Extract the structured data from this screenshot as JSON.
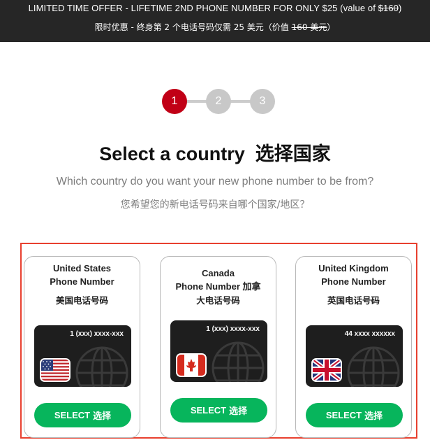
{
  "banner": {
    "line1_prefix": "LIMITED TIME OFFER - LIFETIME 2ND PHONE NUMBER FOR ONLY $25 (value of ",
    "line1_strike": "$160",
    "line1_suffix": ")",
    "line2_prefix": "限时优惠 - 终身第 2 个电话号码仅需 25 美元（价值 ",
    "line2_strike": "160 美元",
    "line2_suffix": "）"
  },
  "steps": [
    {
      "label": "1",
      "active": true
    },
    {
      "label": "2",
      "active": false
    },
    {
      "label": "3",
      "active": false
    }
  ],
  "heading": {
    "title_en": "Select a country",
    "title_zh": "选择国家",
    "subtitle_en": "Which country do you want your new phone number to be from?",
    "subtitle_zh": "您希望您的新电话号码来自哪个国家/地区？"
  },
  "countries": [
    {
      "name_line1": "United States",
      "name_line2": "Phone Number",
      "name_zh": "美国电话号码",
      "number_format": "1 (xxx) xxxx-xxx",
      "flag_icon": "us-flag-icon",
      "select_en": "SELECT",
      "select_zh": "选择"
    },
    {
      "name_line1": "Canada",
      "name_line2": "Phone Number 加拿",
      "name_zh": "大电话号码",
      "number_format": "1 (xxx) xxxx-xxx",
      "flag_icon": "canada-flag-icon",
      "select_en": "SELECT",
      "select_zh": "选择"
    },
    {
      "name_line1": "United Kingdom",
      "name_line2": "Phone Number",
      "name_zh": "英国电话号码",
      "number_format": "44 xxxx xxxxxx",
      "flag_icon": "uk-flag-icon",
      "select_en": "SELECT",
      "select_zh": "选择"
    }
  ],
  "colors": {
    "banner_bg": "#262626",
    "step_active": "#c10016",
    "step_inactive": "#c8c8c8",
    "select_button": "#07b55c",
    "highlight_frame": "#e8402f"
  }
}
